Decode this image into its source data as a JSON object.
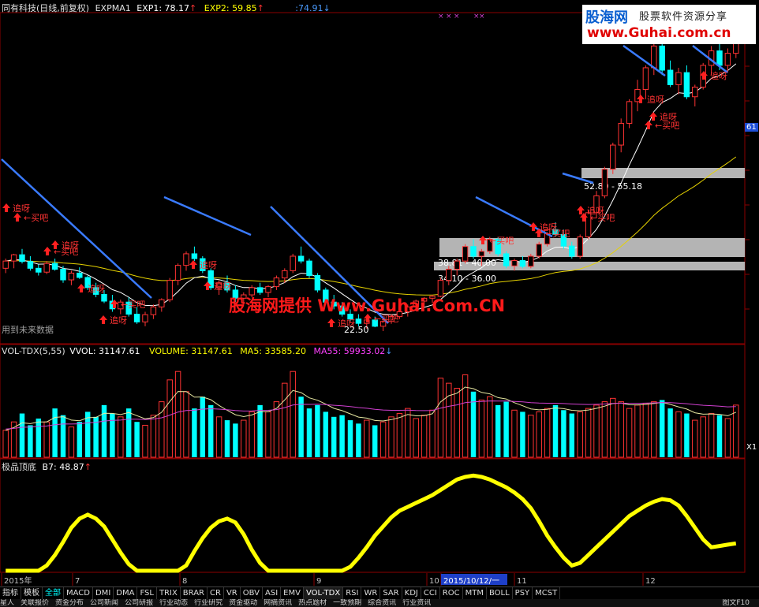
{
  "header": {
    "stock_title": "同有科技(日线,前复权)",
    "indicator": "EXPMA1",
    "exp1_label": "EXP1: 78.17",
    "exp2_label": "EXP2: 59.85",
    "extra_value": ":74.91",
    "arrow_up": "↑",
    "arrow_down": "↓"
  },
  "volume_panel": {
    "title": "VOL-TDX(5,55)",
    "vvol": "VVOL: 31147.61",
    "volume": "VOLUME: 31147.61",
    "ma5": "MA5: 33585.20",
    "ma55": "MA55: 59933.02"
  },
  "indicator_panel": {
    "title": "极品顶底",
    "b7": "B7: 48.87"
  },
  "price_axis_label": "61",
  "volume_axis_label": "X1",
  "notes": {
    "future_data": "用到未来数据"
  },
  "watermark": {
    "center": "股海网提供 Www.Guhai.Com.CN",
    "logo_top_left": "股海网",
    "logo_top_right": "股票软件资源分享",
    "logo_url": "www.Guhai.com.cn"
  },
  "date_axis": {
    "labels": [
      "2015年",
      "7",
      "8",
      "9",
      "10",
      "2015/10/12/一",
      "11",
      "12"
    ]
  },
  "tabs": [
    "指标",
    "模板",
    "全部",
    "MACD",
    "DMI",
    "DMA",
    "FSL",
    "TRIX",
    "BRAR",
    "CR",
    "VR",
    "OBV",
    "ASI",
    "EMV",
    "VOL-TDX",
    "RSI",
    "WR",
    "SAR",
    "KDJ",
    "CCI",
    "ROC",
    "MTM",
    "BOLL",
    "PSY",
    "MCST"
  ],
  "news_items": [
    "星人",
    "关联报价",
    "资金分布",
    "公司新闻",
    "公司研报",
    "行业动态",
    "行业研究",
    "资金驱动",
    "网摘资讯",
    "热点题材",
    "一致预期",
    "综合资讯",
    "行业资讯"
  ],
  "news_right": "图文F10",
  "zone_labels": [
    "52.80 - 55.18",
    "34.10 - 36.00",
    "38.81 - 40.00"
  ],
  "signal_labels": {
    "chase": "追呀",
    "buy": "←买吧",
    "low_price": "22.50"
  },
  "colors": {
    "up": "#ff3333",
    "down": "#00ffff",
    "trend_line": "#3a7bff",
    "ma_white": "#ffffff",
    "ma_yellow": "#e6d200",
    "vol_ma5": "#e6e6a0",
    "vol_ma55": "#d040d0",
    "indicator": "#ffff00",
    "zone": "#b4b4b4"
  },
  "chart_data": [
    {
      "type": "candlestick",
      "title": "同有科技(日线,前复权)",
      "x": [
        "2015年",
        "7",
        "8",
        "9",
        "10",
        "11",
        "12"
      ],
      "series": [
        {
          "name": "EXP1",
          "last": 78.17
        },
        {
          "name": "EXP2",
          "last": 59.85
        }
      ],
      "ohlc": [
        [
          31.0,
          33.0,
          30.0,
          32.5
        ],
        [
          32.5,
          34.0,
          31.0,
          33.8
        ],
        [
          33.8,
          35.0,
          32.0,
          32.4
        ],
        [
          32.4,
          33.5,
          30.5,
          31.0
        ],
        [
          31.0,
          31.8,
          29.5,
          30.2
        ],
        [
          30.2,
          32.5,
          29.8,
          32.0
        ],
        [
          32.0,
          33.0,
          30.5,
          30.8
        ],
        [
          30.8,
          31.5,
          28.0,
          28.6
        ],
        [
          28.6,
          30.5,
          27.5,
          30.0
        ],
        [
          30.0,
          31.2,
          28.8,
          29.1
        ],
        [
          29.1,
          29.5,
          26.5,
          27.0
        ],
        [
          27.0,
          28.0,
          25.0,
          25.6
        ],
        [
          25.6,
          26.5,
          23.8,
          24.2
        ],
        [
          24.2,
          25.5,
          22.0,
          22.6
        ],
        [
          22.6,
          24.5,
          21.5,
          24.0
        ],
        [
          24.0,
          25.0,
          21.0,
          21.5
        ],
        [
          21.5,
          23.0,
          19.5,
          19.9
        ],
        [
          19.9,
          22.0,
          19.0,
          21.4
        ],
        [
          21.4,
          23.5,
          20.5,
          23.0
        ],
        [
          23.0,
          24.8,
          22.0,
          24.5
        ],
        [
          24.5,
          29.0,
          24.0,
          28.5
        ],
        [
          28.5,
          32.0,
          27.5,
          31.6
        ],
        [
          31.6,
          34.5,
          30.5,
          34.0
        ],
        [
          34.0,
          35.5,
          32.5,
          33.0
        ],
        [
          33.0,
          33.5,
          30.0,
          30.5
        ],
        [
          30.5,
          31.0,
          26.5,
          27.0
        ],
        [
          27.0,
          28.5,
          25.5,
          28.0
        ],
        [
          28.0,
          29.5,
          26.0,
          26.5
        ],
        [
          26.5,
          27.5,
          24.0,
          24.8
        ],
        [
          24.8,
          26.0,
          23.5,
          25.5
        ],
        [
          25.5,
          27.5,
          25.0,
          27.0
        ],
        [
          27.0,
          28.0,
          25.5,
          26.0
        ],
        [
          26.0,
          27.5,
          25.0,
          27.2
        ],
        [
          27.2,
          29.5,
          26.5,
          29.0
        ],
        [
          29.0,
          31.0,
          28.0,
          30.5
        ],
        [
          30.5,
          34.0,
          30.0,
          33.5
        ],
        [
          33.5,
          35.5,
          32.0,
          32.5
        ],
        [
          32.5,
          33.0,
          29.0,
          29.5
        ],
        [
          29.5,
          30.0,
          26.0,
          26.5
        ],
        [
          26.5,
          27.0,
          23.5,
          24.0
        ],
        [
          24.0,
          25.5,
          22.5,
          23.2
        ],
        [
          23.2,
          24.0,
          21.0,
          21.5
        ],
        [
          21.5,
          22.5,
          20.0,
          20.5
        ],
        [
          20.5,
          21.5,
          19.0,
          19.6
        ],
        [
          19.6,
          21.0,
          18.5,
          20.3
        ],
        [
          20.3,
          21.0,
          18.8,
          19.0
        ],
        [
          19.0,
          20.5,
          18.0,
          20.0
        ],
        [
          20.0,
          21.5,
          19.5,
          21.0
        ],
        [
          21.0,
          22.5,
          20.5,
          22.0
        ],
        [
          22.0,
          23.5,
          21.0,
          23.0
        ],
        [
          23.0,
          24.5,
          22.5,
          24.2
        ],
        [
          24.2,
          25.0,
          23.0,
          24.8
        ],
        [
          24.8,
          25.5,
          23.8,
          25.2
        ],
        [
          25.2,
          29.0,
          25.0,
          28.5
        ],
        [
          28.5,
          31.5,
          27.5,
          30.8
        ],
        [
          30.8,
          33.0,
          29.5,
          32.5
        ],
        [
          32.5,
          36.0,
          32.0,
          35.5
        ],
        [
          35.5,
          37.0,
          33.0,
          33.5
        ],
        [
          33.5,
          35.0,
          31.5,
          34.5
        ],
        [
          34.5,
          37.5,
          34.0,
          37.0
        ],
        [
          37.0,
          37.5,
          33.5,
          34.0
        ],
        [
          34.0,
          34.5,
          31.0,
          31.5
        ],
        [
          31.5,
          33.0,
          30.5,
          32.6
        ],
        [
          32.6,
          33.5,
          31.0,
          31.4
        ],
        [
          31.4,
          34.0,
          31.0,
          33.5
        ],
        [
          33.5,
          36.5,
          33.0,
          36.0
        ],
        [
          36.0,
          39.5,
          35.5,
          39.0
        ],
        [
          39.0,
          40.5,
          37.5,
          38.0
        ],
        [
          38.0,
          39.0,
          35.0,
          35.6
        ],
        [
          35.6,
          36.5,
          33.0,
          33.5
        ],
        [
          33.5,
          38.0,
          33.0,
          37.5
        ],
        [
          37.5,
          43.0,
          37.0,
          42.5
        ],
        [
          42.5,
          47.0,
          41.5,
          46.0
        ],
        [
          46.0,
          52.0,
          45.5,
          51.5
        ],
        [
          51.5,
          57.0,
          50.5,
          56.5
        ],
        [
          56.5,
          62.0,
          55.0,
          61.0
        ],
        [
          61.0,
          66.0,
          60.0,
          65.5
        ],
        [
          65.5,
          70.0,
          63.5,
          68.0
        ],
        [
          68.0,
          73.0,
          66.0,
          72.5
        ],
        [
          72.5,
          78.0,
          71.0,
          77.0
        ],
        [
          77.0,
          79.0,
          71.0,
          72.0
        ],
        [
          72.0,
          74.0,
          68.5,
          69.0
        ],
        [
          69.0,
          72.5,
          67.0,
          71.5
        ],
        [
          71.5,
          73.0,
          66.0,
          66.5
        ],
        [
          66.5,
          69.0,
          64.5,
          68.5
        ],
        [
          68.5,
          73.5,
          68.0,
          73.0
        ],
        [
          73.0,
          77.0,
          71.0,
          76.0
        ],
        [
          76.0,
          78.5,
          72.0,
          73.0
        ],
        [
          73.0,
          76.5,
          71.5,
          75.5
        ],
        [
          75.5,
          79.0,
          74.5,
          78.2
        ]
      ],
      "volume": [
        16000,
        21000,
        26000,
        19000,
        23000,
        21000,
        29000,
        25000,
        18000,
        21000,
        27000,
        24000,
        31000,
        26000,
        24000,
        29000,
        21000,
        19000,
        25000,
        33000,
        46000,
        51000,
        39000,
        29000,
        36000,
        31000,
        24000,
        22000,
        20000,
        22000,
        27000,
        31000,
        27000,
        33000,
        44000,
        51000,
        36000,
        29000,
        31000,
        27000,
        24000,
        25000,
        22000,
        20000,
        22000,
        19000,
        21000,
        24000,
        26000,
        29000,
        23000,
        25000,
        28000,
        47000,
        44000,
        41000,
        49000,
        39000,
        34000,
        36000,
        31000,
        33000,
        28000,
        27000,
        25000,
        27000,
        29000,
        31000,
        28000,
        26000,
        27000,
        29000,
        31000,
        33000,
        35000,
        33000,
        29000,
        31000,
        32000,
        33000,
        34000,
        29000,
        27000,
        26000,
        22000,
        24000,
        26000,
        25000,
        23000,
        31000
      ],
      "indicator": [
        0,
        0,
        0,
        0,
        0,
        4,
        12,
        22,
        33,
        40,
        43,
        40,
        34,
        24,
        14,
        5,
        0,
        0,
        0,
        0,
        0,
        0,
        4,
        15,
        25,
        33,
        38,
        40,
        37,
        28,
        16,
        6,
        0,
        0,
        0,
        0,
        0,
        0,
        0,
        0,
        0,
        0,
        3,
        10,
        18,
        27,
        34,
        41,
        46,
        49,
        52,
        55,
        58,
        62,
        66,
        70,
        72,
        73,
        72,
        70,
        67,
        64,
        60,
        55,
        48,
        38,
        27,
        18,
        10,
        4,
        6,
        12,
        18,
        24,
        30,
        36,
        42,
        46,
        50,
        53,
        55,
        54,
        50,
        42,
        33,
        24,
        18,
        19,
        20,
        21
      ]
    }
  ]
}
